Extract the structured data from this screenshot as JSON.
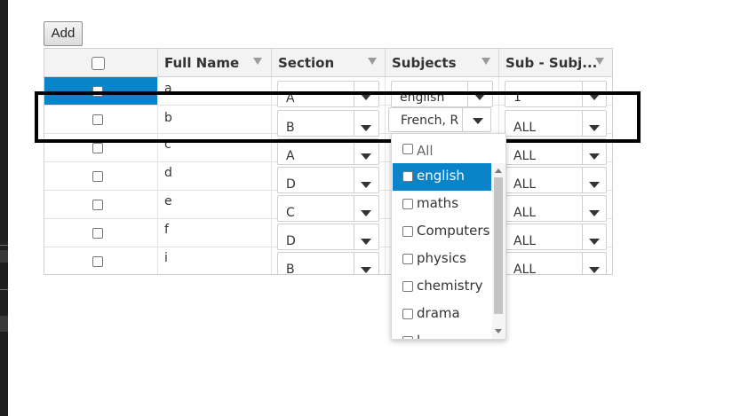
{
  "toolbar": {
    "add_label": "Add"
  },
  "columns": [
    "",
    "Full Name",
    "Section",
    "Subjects",
    "Sub - Subj..."
  ],
  "rows": [
    {
      "name": "a",
      "section": "A",
      "subjects": "english",
      "sub": "1"
    },
    {
      "name": "b",
      "section": "B",
      "subjects": "French, R",
      "sub": "ALL"
    },
    {
      "name": "c",
      "section": "A",
      "subjects": "",
      "sub": "ALL"
    },
    {
      "name": "d",
      "section": "D",
      "subjects": "",
      "sub": "ALL"
    },
    {
      "name": "e",
      "section": "C",
      "subjects": "",
      "sub": "ALL"
    },
    {
      "name": "f",
      "section": "D",
      "subjects": "",
      "sub": "ALL"
    },
    {
      "name": "i",
      "section": "B",
      "subjects": "",
      "sub": "ALL"
    }
  ],
  "popup": {
    "options": [
      "All",
      "english",
      "maths",
      "Computers",
      "physics",
      "chemistry",
      "drama",
      "l"
    ],
    "active_index": 1
  },
  "icons": {
    "filter": "filter-funnel-icon",
    "dropdown": "chevron-down-icon",
    "scroll_up": "scroll-up-arrow-icon",
    "scroll_down": "scroll-down-arrow-icon"
  },
  "colors": {
    "selection": "#0a83c8",
    "header_bg": "#f3f3f3",
    "highlight_border": "#000000"
  }
}
